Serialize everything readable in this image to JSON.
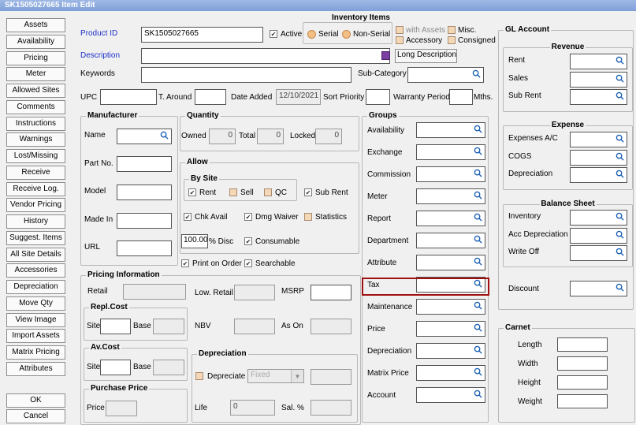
{
  "window": {
    "title": "SK1505027665 Item Edit"
  },
  "sidebar": {
    "buttons": [
      "Assets",
      "Availability",
      "Pricing",
      "Meter",
      "Allowed Sites",
      "Comments",
      "Instructions",
      "Warnings",
      "Lost/Missing",
      "Receive",
      "Receive Log.",
      "Vendor Pricing",
      "History",
      "Suggest. Items",
      "All Site Details",
      "Accessories",
      "Depreciation",
      "Move Qty",
      "View Image",
      "Import Assets",
      "Matrix Pricing",
      "Attributes"
    ],
    "ok": "OK",
    "cancel": "Cancel"
  },
  "header": {
    "product_id_label": "Product ID",
    "product_id_value": "SK1505027665",
    "active_label": "Active",
    "inventory_items_title": "Inventory Items",
    "serial_label": "Serial",
    "non_serial_label": "Non-Serial",
    "with_assets_label": "with Assets",
    "accessory_label": "Accessory",
    "misc_label": "Misc.",
    "consigned_label": "Consigned",
    "description_label": "Description",
    "long_description_label": "Long Description",
    "keywords_label": "Keywords",
    "subcategory_label": "Sub-Category",
    "upc_label": "UPC",
    "turnaround_label": "T. Around",
    "date_added_label": "Date Added",
    "date_added_value": "12/10/2021",
    "sort_priority_label": "Sort Priority",
    "warranty_label": "Warranty Period",
    "mths_label": "Mths."
  },
  "manufacturer": {
    "title": "Manufacturer",
    "name_label": "Name",
    "part_no_label": "Part No.",
    "model_label": "Model",
    "made_in_label": "Made In",
    "url_label": "URL"
  },
  "quantity": {
    "title": "Quantity",
    "owned_label": "Owned",
    "owned_value": "0",
    "total_label": "Total",
    "total_value": "0",
    "locked_label": "Locked",
    "locked_value": "0"
  },
  "allow": {
    "title": "Allow",
    "by_site_title": "By Site",
    "rent_label": "Rent",
    "sell_label": "Sell",
    "qc_label": "QC",
    "sub_rent_label": "Sub Rent",
    "chk_avail_label": "Chk Avail",
    "dmg_waiver_label": "Dmg Waiver",
    "statistics_label": "Statistics",
    "disc_value": "100.00",
    "disc_label": "% Disc",
    "consumable_label": "Consumable",
    "print_on_order_label": "Print on Order",
    "searchable_label": "Searchable"
  },
  "pricing": {
    "title": "Pricing Information",
    "retail_label": "Retail",
    "low_retail_label": "Low. Retail",
    "msrp_label": "MSRP",
    "repl_cost_title": "Repl.Cost",
    "site_label": "Site",
    "base_label": "Base",
    "nbv_label": "NBV",
    "as_on_label": "As On",
    "av_cost_title": "Av.Cost",
    "purchase_price_title": "Purchase Price",
    "price_label": "Price"
  },
  "depreciation": {
    "title": "Depreciation",
    "depreciate_label": "Depreciate",
    "method_value": "Fixed",
    "life_label": "Life",
    "life_value": "0",
    "sal_label": "Sal. %"
  },
  "groups": {
    "title": "Groups",
    "items": [
      "Availability",
      "Exchange",
      "Commission",
      "Meter",
      "Report",
      "Department",
      "Attribute",
      "Tax",
      "Maintenance",
      "Price",
      "Depreciation",
      "Matrix Price",
      "Account"
    ]
  },
  "gl_account": {
    "title": "GL Account",
    "revenue_title": "Revenue",
    "revenue_items": [
      "Rent",
      "Sales",
      "Sub Rent"
    ],
    "expense_title": "Expense",
    "expense_items": [
      "Expenses A/C",
      "COGS",
      "Depreciation"
    ],
    "balance_title": "Balance Sheet",
    "balance_items": [
      "Inventory",
      "Acc Depreciation",
      "Write Off"
    ],
    "discount_label": "Discount"
  },
  "carnet": {
    "title": "Carnet",
    "items": [
      "Length",
      "Width",
      "Height",
      "Weight"
    ]
  },
  "colors": {
    "title_bar": "#7fa0d8",
    "highlight": "#a01010",
    "label_blue": "#1b2fc9"
  }
}
